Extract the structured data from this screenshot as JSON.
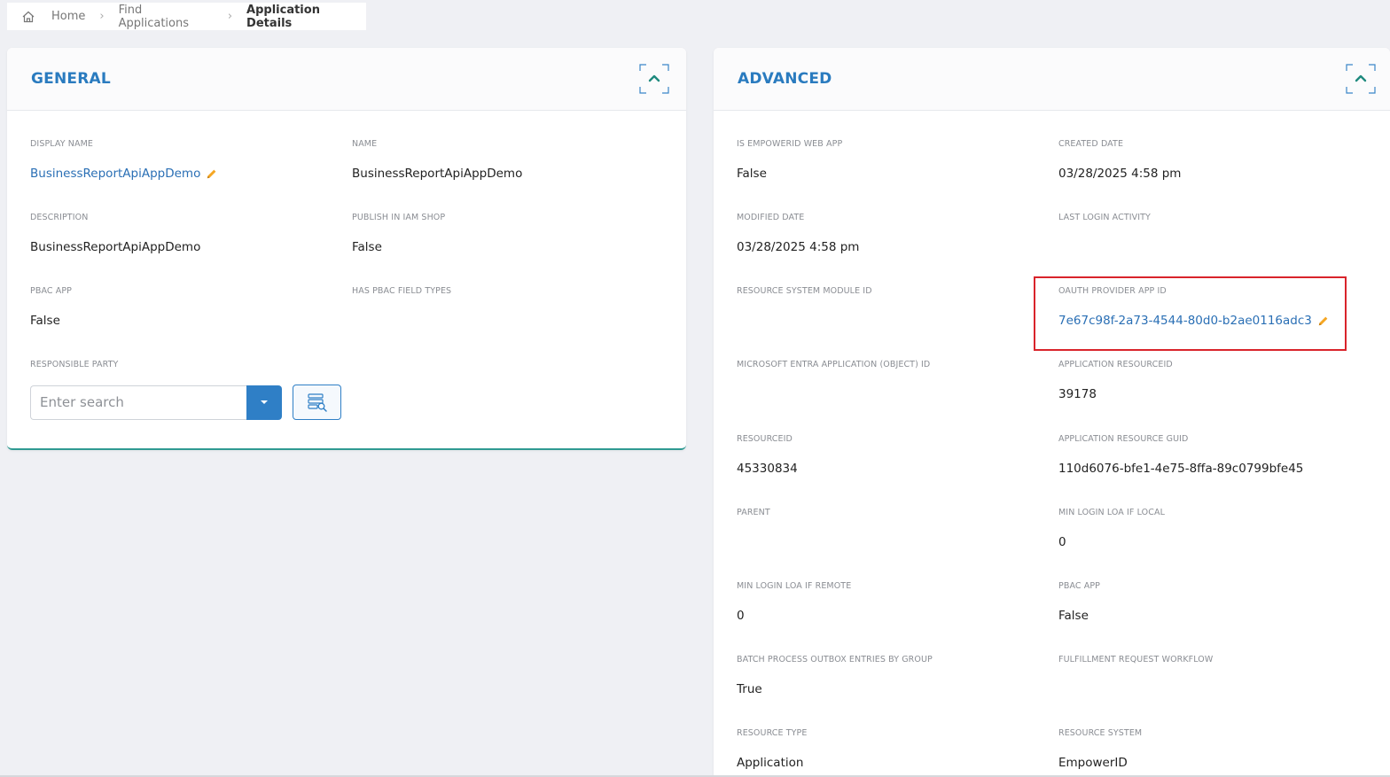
{
  "breadcrumb": {
    "home_icon": "home-icon",
    "items": [
      "Home",
      "Find Applications",
      "Application Details"
    ]
  },
  "general": {
    "title": "GENERAL",
    "fields": {
      "display_name": {
        "label": "DISPLAY NAME",
        "value": "BusinessReportApiAppDemo"
      },
      "name": {
        "label": "NAME",
        "value": "BusinessReportApiAppDemo"
      },
      "description": {
        "label": "DESCRIPTION",
        "value": "BusinessReportApiAppDemo"
      },
      "publish_in_iam_shop": {
        "label": "PUBLISH IN IAM SHOP",
        "value": "False"
      },
      "pbac_app": {
        "label": "PBAC APP",
        "value": "False"
      },
      "has_pbac_field_types": {
        "label": "HAS PBAC FIELD TYPES",
        "value": ""
      },
      "responsible_party": {
        "label": "RESPONSIBLE PARTY",
        "placeholder": "Enter search"
      }
    }
  },
  "advanced": {
    "title": "ADVANCED",
    "fields": {
      "is_empowerid_web_app": {
        "label": "IS EMPOWERID WEB APP",
        "value": "False"
      },
      "created_date": {
        "label": "CREATED DATE",
        "value": "03/28/2025 4:58 pm"
      },
      "modified_date": {
        "label": "MODIFIED DATE",
        "value": "03/28/2025 4:58 pm"
      },
      "last_login_activity": {
        "label": "LAST LOGIN ACTIVITY",
        "value": ""
      },
      "resource_system_module_id": {
        "label": "RESOURCE SYSTEM MODULE ID",
        "value": ""
      },
      "oauth_provider_app_id": {
        "label": "OAUTH PROVIDER APP ID",
        "value": "7e67c98f-2a73-4544-80d0-b2ae0116adc3"
      },
      "entra_object_id": {
        "label": "MICROSOFT ENTRA APPLICATION (OBJECT) ID",
        "value": ""
      },
      "application_resourceid": {
        "label": "APPLICATION RESOURCEID",
        "value": "39178"
      },
      "resourceid": {
        "label": "RESOURCEID",
        "value": "45330834"
      },
      "application_resource_guid": {
        "label": "APPLICATION RESOURCE GUID",
        "value": "110d6076-bfe1-4e75-8ffa-89c0799bfe45"
      },
      "parent": {
        "label": "PARENT",
        "value": ""
      },
      "min_login_loa_if_local": {
        "label": "MIN LOGIN LOA IF LOCAL",
        "value": "0"
      },
      "min_login_loa_if_remote": {
        "label": "MIN LOGIN LOA IF REMOTE",
        "value": "0"
      },
      "pbac_app": {
        "label": "PBAC APP",
        "value": "False"
      },
      "batch_process_outbox": {
        "label": "BATCH PROCESS OUTBOX ENTRIES BY GROUP",
        "value": "True"
      },
      "fulfillment_request_workflow": {
        "label": "FULFILLMENT REQUEST WORKFLOW",
        "value": ""
      },
      "resource_type": {
        "label": "RESOURCE TYPE",
        "value": "Application"
      },
      "resource_system": {
        "label": "RESOURCE SYSTEM",
        "value": "EmpowerID"
      }
    }
  },
  "colors": {
    "accent": "#2a7bbf",
    "link": "#2a6fb5",
    "edit_icon": "#f5a623",
    "highlight": "#d9242b",
    "collapse_icon": "#1f8a7e"
  }
}
